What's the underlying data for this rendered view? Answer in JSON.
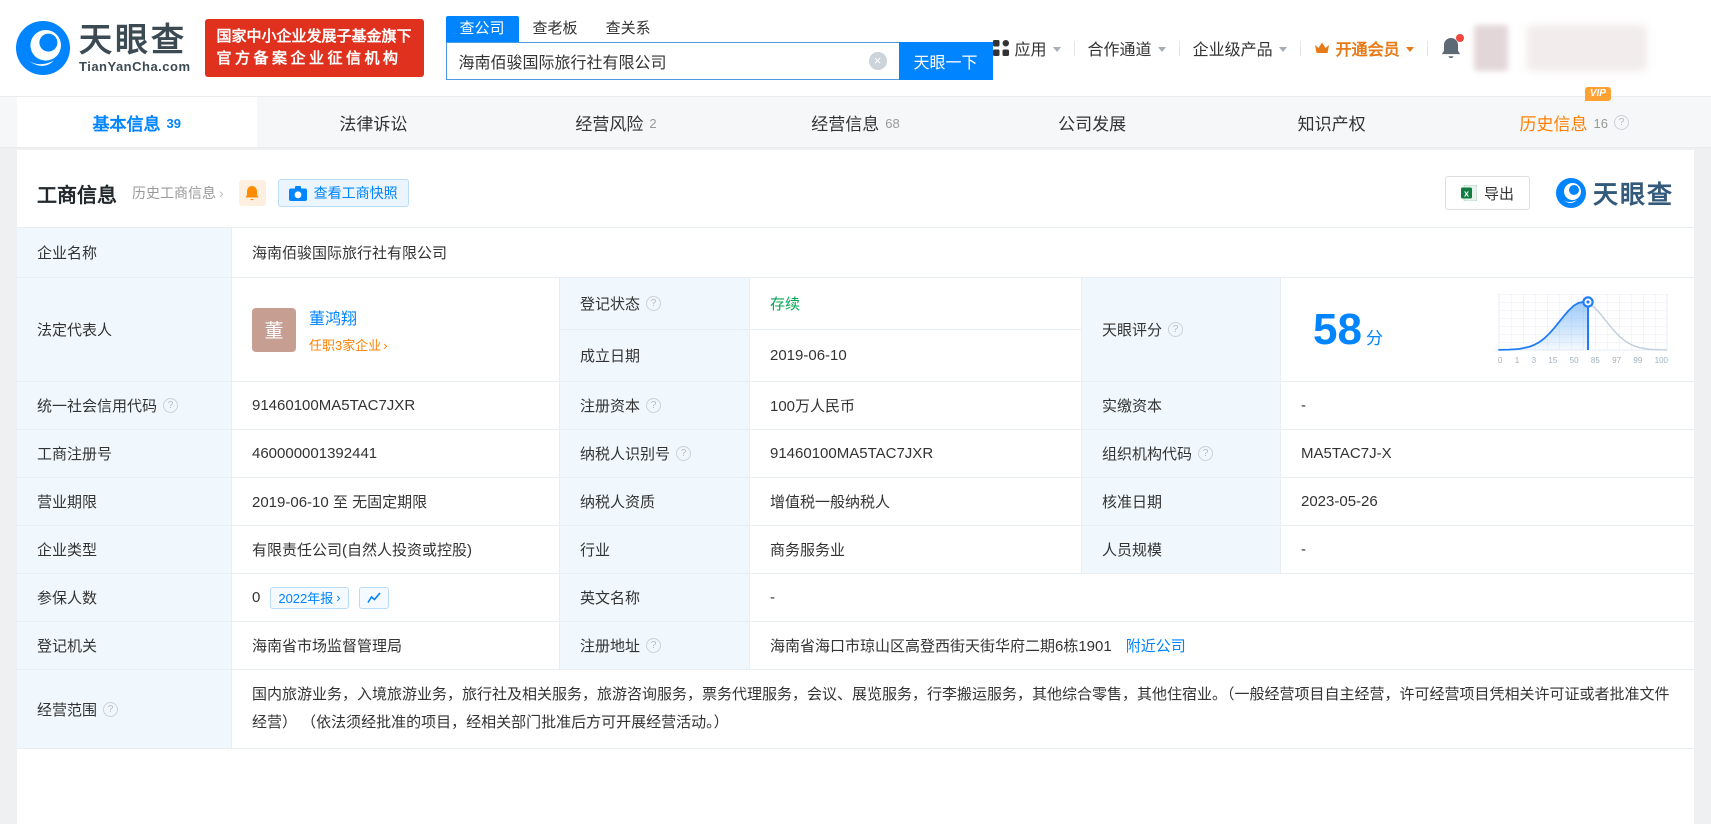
{
  "colors": {
    "accent_blue": "#0084ff",
    "link_orange": "#ff8000",
    "status_green": "#00a854",
    "badge_red": "#e0301e",
    "vip_orange": "#e67a17"
  },
  "brand": {
    "logo_title": "天眼查",
    "logo_subtitle": "TianYanCha.com",
    "badge_line1": "国家中小企业发展子基金旗下",
    "badge_line2": "官方备案企业征信机构"
  },
  "search": {
    "tabs": [
      {
        "label": "查公司"
      },
      {
        "label": "查老板"
      },
      {
        "label": "查关系"
      }
    ],
    "value": "海南佰骏国际旅行社有限公司",
    "button_label": "天眼一下"
  },
  "top_nav": {
    "apps": "应用",
    "coop": "合作通道",
    "enterprise": "企业级产品",
    "vip": "开通会员"
  },
  "tabs": {
    "items": [
      {
        "label": "基本信息",
        "count": "39"
      },
      {
        "label": "法律诉讼",
        "count": ""
      },
      {
        "label": "经营风险",
        "count": "2"
      },
      {
        "label": "经营信息",
        "count": "68"
      },
      {
        "label": "公司发展",
        "count": ""
      },
      {
        "label": "知识产权",
        "count": ""
      },
      {
        "label": "历史信息",
        "count": "16",
        "vip_badge": "VIP"
      }
    ]
  },
  "section": {
    "title": "工商信息",
    "history_link": "历史工商信息",
    "snapshot_button": "查看工商快照",
    "export_button": "导出",
    "watermark": "天眼查"
  },
  "company": {
    "name_label": "企业名称",
    "name": "海南佰骏国际旅行社有限公司",
    "legal_rep_label": "法定代表人",
    "legal_rep_avatar": "董",
    "legal_rep_name": "董鸿翔",
    "legal_rep_positions": "任职3家企业",
    "reg_status_label": "登记状态",
    "reg_status": "存续",
    "establish_date_label": "成立日期",
    "establish_date": "2019-06-10",
    "score_label": "天眼评分",
    "credit_code_label": "统一社会信用代码",
    "credit_code": "91460100MA5TAC7JXR",
    "reg_capital_label": "注册资本",
    "reg_capital": "100万人民币",
    "paid_capital_label": "实缴资本",
    "paid_capital": "-",
    "reg_number_label": "工商注册号",
    "reg_number": "460000001392441",
    "taxpayer_id_label": "纳税人识别号",
    "taxpayer_id": "91460100MA5TAC7JXR",
    "org_code_label": "组织机构代码",
    "org_code": "MA5TAC7J-X",
    "term_label": "营业期限",
    "term": "2019-06-10 至 无固定期限",
    "taxpayer_quality_label": "纳税人资质",
    "taxpayer_quality": "增值税一般纳税人",
    "approval_date_label": "核准日期",
    "approval_date": "2023-05-26",
    "type_label": "企业类型",
    "type": "有限责任公司(自然人投资或控股)",
    "industry_label": "行业",
    "industry": "商务服务业",
    "staff_label": "人员规模",
    "staff": "-",
    "insured_label": "参保人数",
    "insured": "0",
    "annual_report": "2022年报",
    "english_label": "英文名称",
    "english_name": "-",
    "authority_label": "登记机关",
    "authority": "海南省市场监督管理局",
    "address_label": "注册地址",
    "address": "海南省海口市琼山区高登西街天街华府二期6栋1901",
    "nearby": "附近公司",
    "scope_label": "经营范围",
    "scope": "国内旅游业务，入境旅游业务，旅行社及相关服务，旅游咨询服务，票务代理服务，会议、展览服务，行李搬运服务，其他综合零售，其他住宿业。（一般经营项目自主经营，许可经营项目凭相关许可证或者批准文件经营） （依法须经批准的项目，经相关部门批准后方可开展经营活动。）"
  },
  "score_chart": {
    "type": "area",
    "score": "58",
    "unit": "分",
    "ticks": [
      "0",
      "1",
      "3",
      "15",
      "50",
      "85",
      "97",
      "99",
      "100"
    ],
    "marker_percentile": 58
  }
}
